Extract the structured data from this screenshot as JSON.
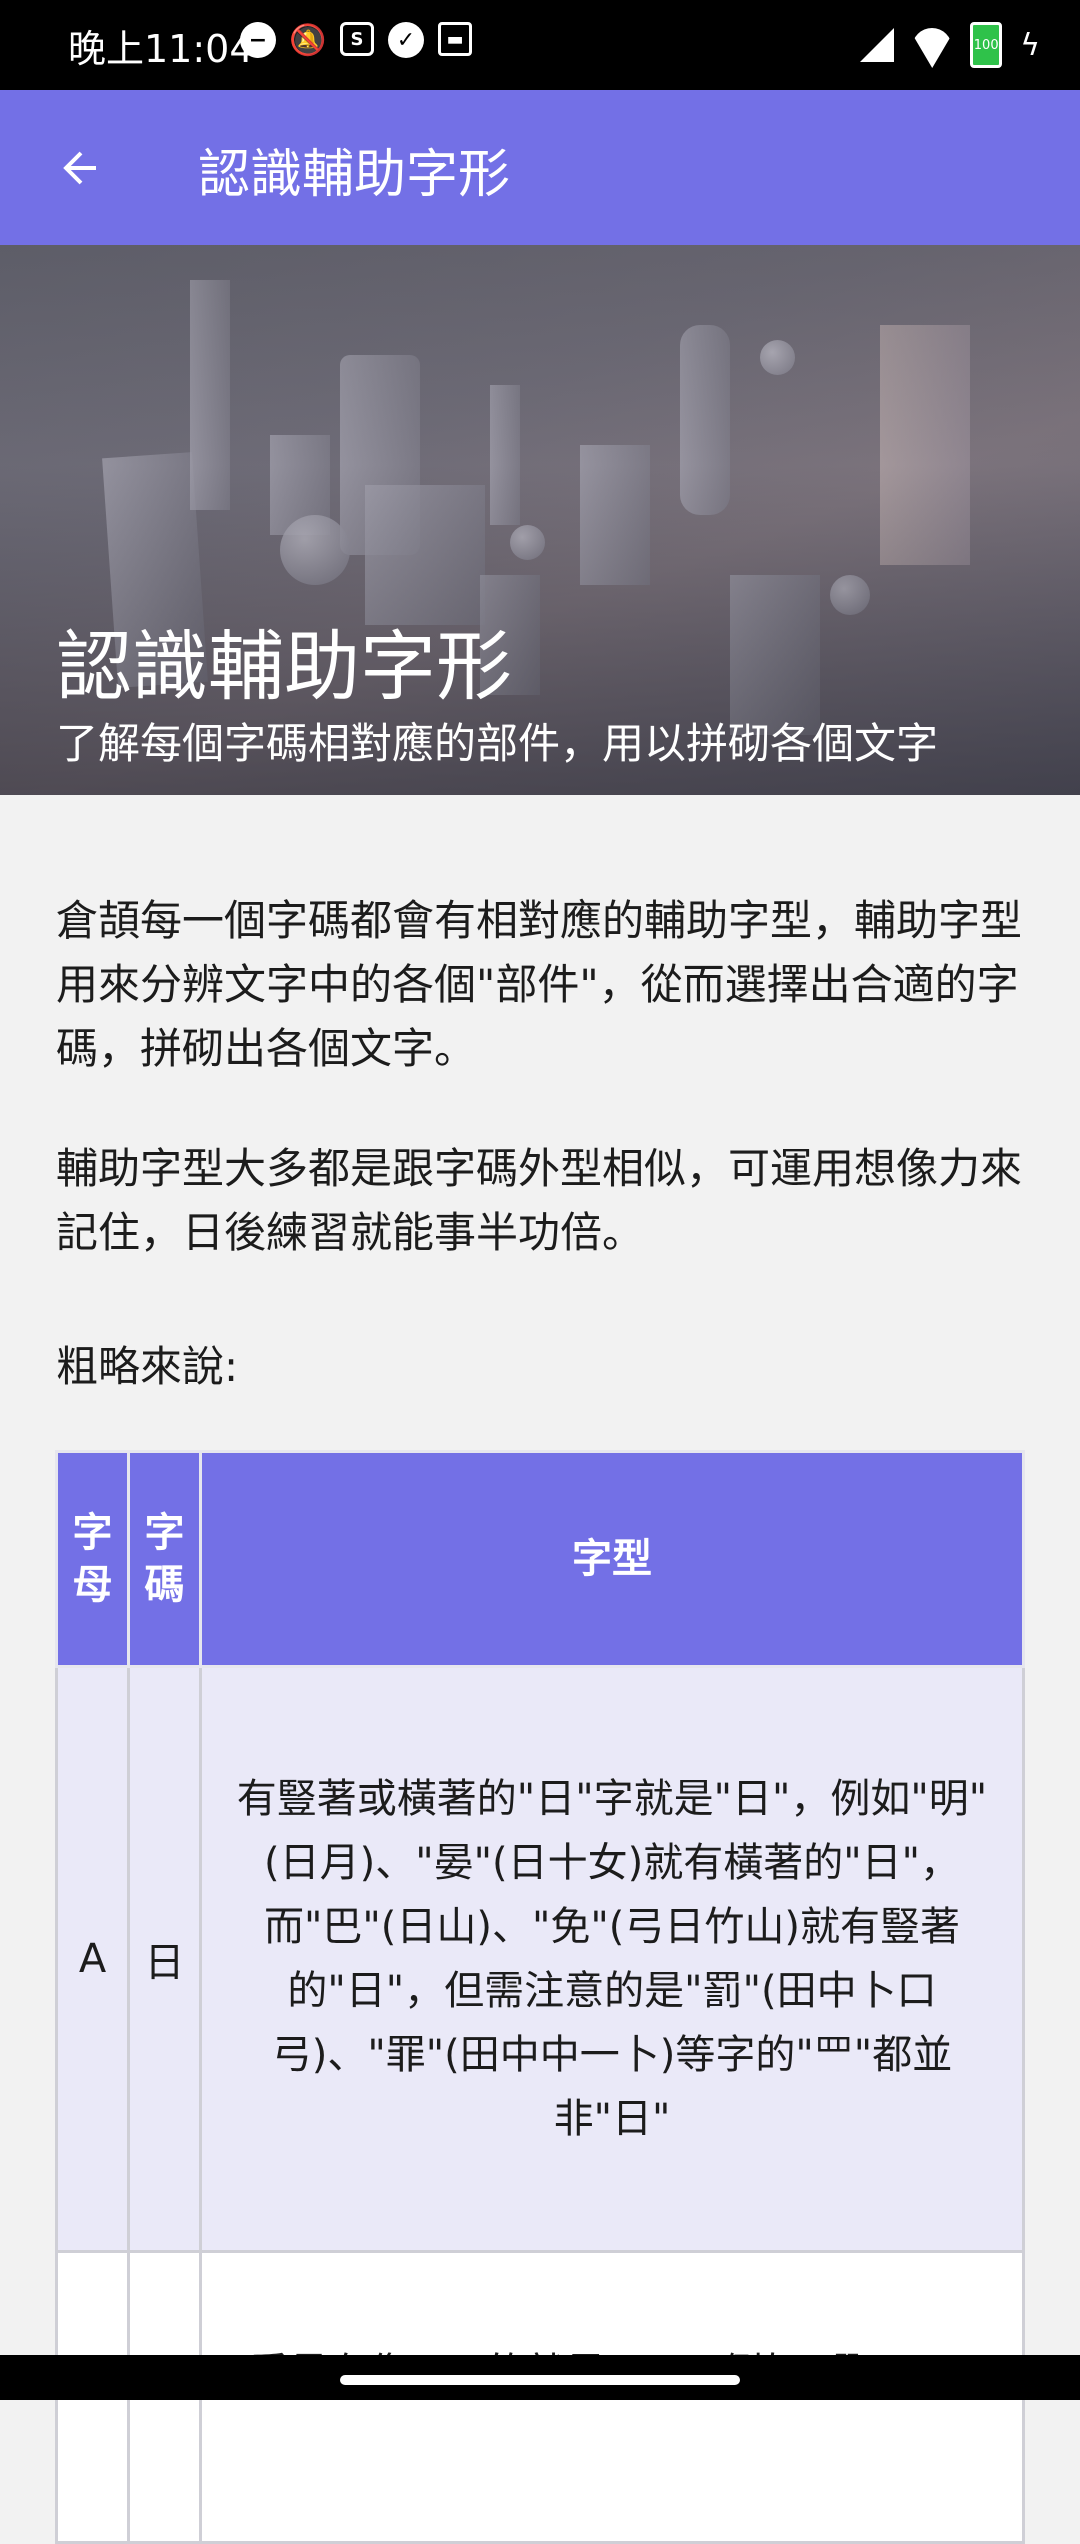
{
  "status_bar": {
    "time": "晚上11:04",
    "battery_level": "100",
    "icons": [
      "dnd-icon",
      "mute-icon",
      "sim-icon",
      "check-icon",
      "notification-icon",
      "signal-icon",
      "wifi-icon",
      "battery-icon",
      "charging-icon"
    ]
  },
  "app_bar": {
    "title": "認識輔助字形"
  },
  "hero": {
    "title": "認識輔助字形",
    "subtitle": "了解每個字碼相對應的部件，用以拼砌各個文字"
  },
  "body": {
    "paragraph1": "倉頡每一個字碼都會有相對應的輔助字型，輔助字型用來分辨文字中的各個\"部件\"，從而選擇出合適的字碼，拼砌出各個文字。",
    "paragraph2": "輔助字型大多都是跟字碼外型相似，可運用想像力來記住，日後練習就能事半功倍。",
    "label": "粗略來說:"
  },
  "table": {
    "headers": [
      "字母",
      "字碼",
      "字型"
    ],
    "rows": [
      {
        "letter": "A",
        "code": "日",
        "shape": "有豎著或橫著的\"日\"字就是\"日\"，例如\"明\"(日月)、\"晏\"(日十女)就有橫著的\"日\"，而\"巴\"(日山)、\"免\"(弓日竹山)就有豎著的\"日\"，但需注意的是\"罰\"(田中卜口弓)、\"罪\"(田中中一卜)等字的\"罒\"都並非\"日\""
      },
      {
        "letter": "",
        "code": "",
        "shape": "看見有像\"日\"的就是\"日\"，例如\"曜\"(日田"
      }
    ]
  },
  "colors": {
    "accent": "#7370e6",
    "row_highlight": "#eae9f8"
  }
}
